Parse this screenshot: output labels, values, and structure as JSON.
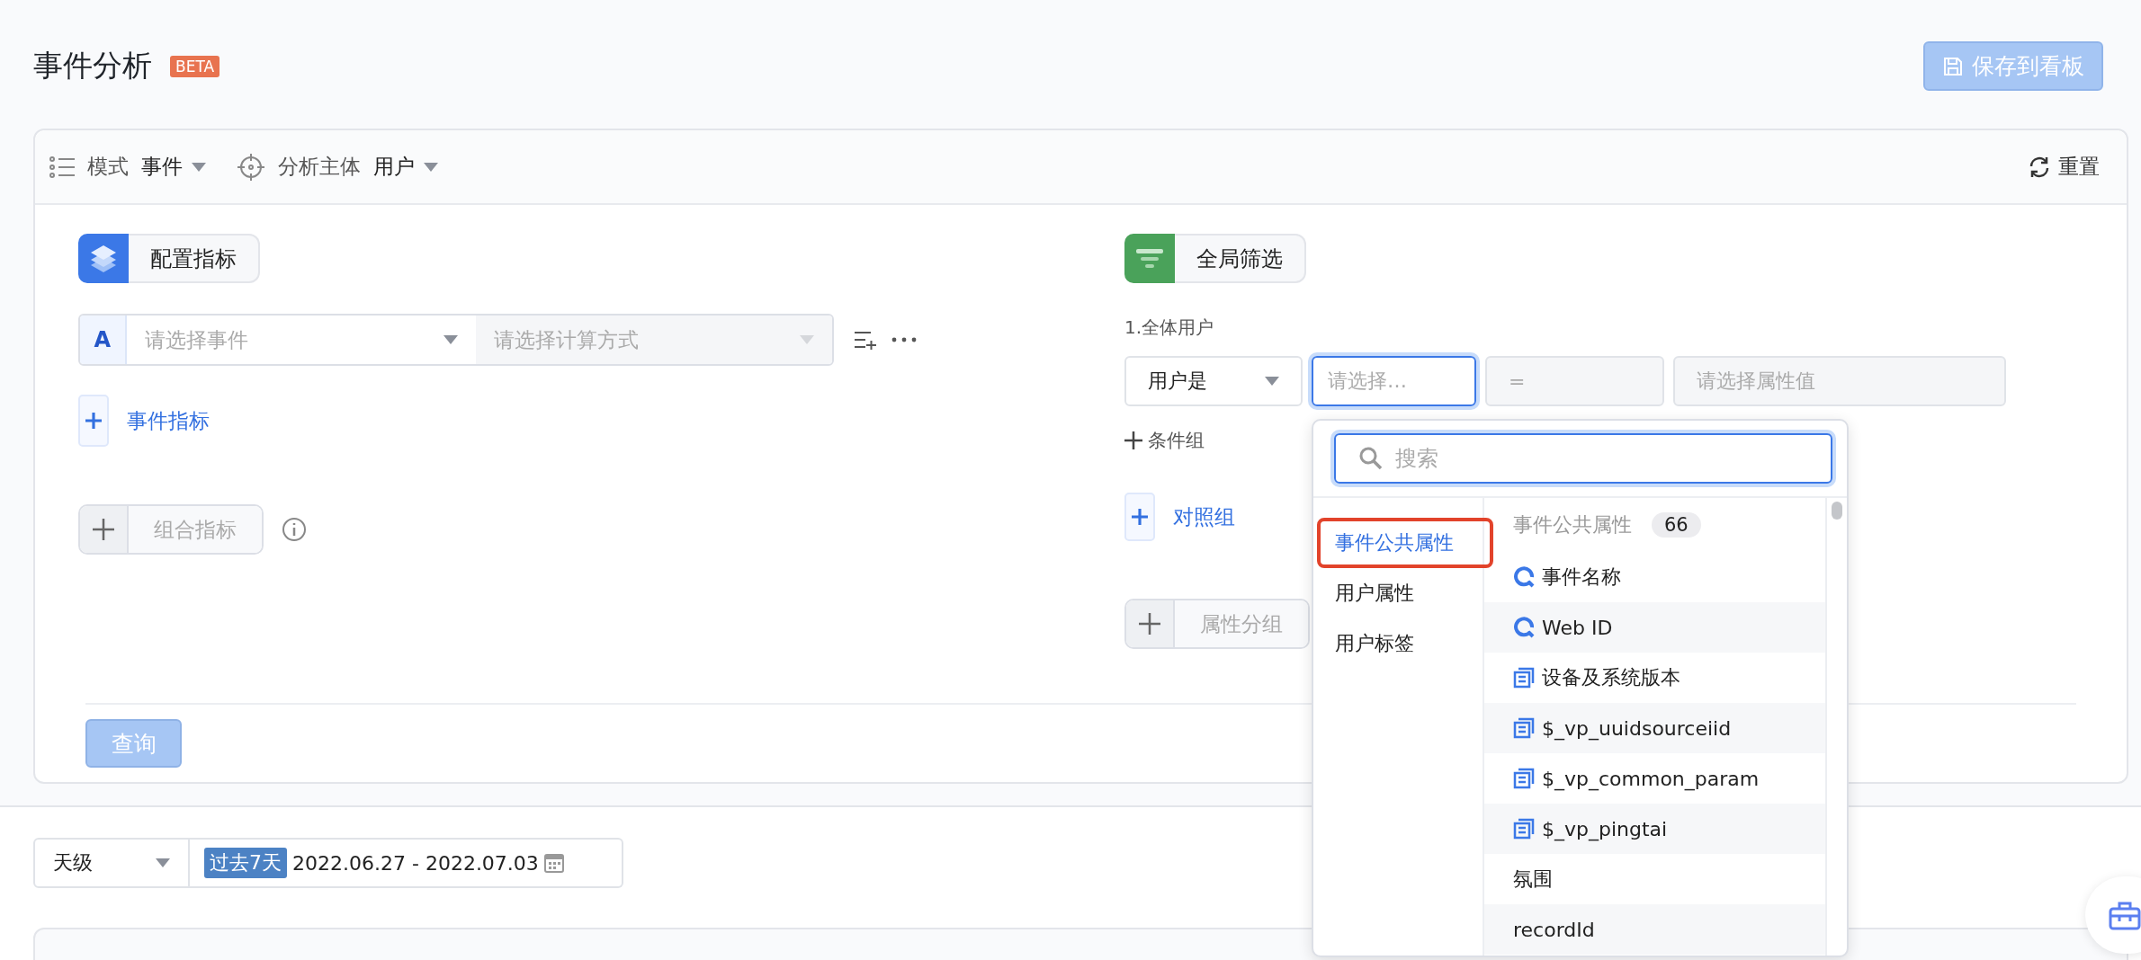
{
  "page": {
    "title": "事件分析",
    "badge": "BETA",
    "save_button": "保存到看板"
  },
  "toolbar": {
    "mode_label": "模式",
    "mode_value": "事件",
    "subject_label": "分析主体",
    "subject_value": "用户",
    "reset": "重置"
  },
  "metrics": {
    "header": "配置指标",
    "rows": [
      {
        "letter": "A",
        "event_placeholder": "请选择事件",
        "calc_placeholder": "请选择计算方式"
      }
    ],
    "add_event": "事件指标",
    "add_combo": "组合指标"
  },
  "filters": {
    "header": "全局筛选",
    "group_title": "1.全体用户",
    "subject": "用户是",
    "property_placeholder": "请选择…",
    "operator": "=",
    "value_placeholder": "请选择属性值",
    "add_condition": "条件组",
    "add_compare": "对照组",
    "group_by": "属性分组"
  },
  "query_button": "查询",
  "dropdown": {
    "search_placeholder": "搜索",
    "categories": [
      {
        "label": "事件公共属性",
        "selected": true,
        "highlighted": true
      },
      {
        "label": "用户属性",
        "selected": false,
        "highlighted": false
      },
      {
        "label": "用户标签",
        "selected": false,
        "highlighted": false
      }
    ],
    "list_header": "事件公共属性",
    "count": "66",
    "items": [
      {
        "label": "事件名称",
        "kind": "preset"
      },
      {
        "label": "Web ID",
        "kind": "preset"
      },
      {
        "label": "设备及系统版本",
        "kind": "custom"
      },
      {
        "label": "$_vp_uuidsourceiid",
        "kind": "custom"
      },
      {
        "label": "$_vp_common_param",
        "kind": "custom"
      },
      {
        "label": "$_vp_pingtai",
        "kind": "custom"
      },
      {
        "label": "氛围",
        "kind": "plain"
      },
      {
        "label": "recordId",
        "kind": "plain"
      }
    ]
  },
  "date_bar": {
    "granularity": "天级",
    "preset": "过去7天",
    "range": "2022.06.27 - 2022.07.03"
  }
}
